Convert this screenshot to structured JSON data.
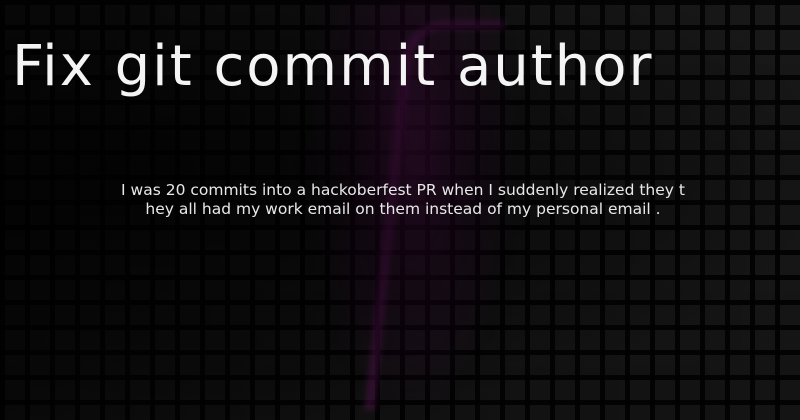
{
  "header": {
    "title": "Fix git commit author"
  },
  "main": {
    "description": "I was 20 commits into a hackoberfest PR when I suddenly realized they they all had my work email on them instead of my personal email ."
  },
  "colors": {
    "background": "#0d0d0d",
    "text": "#f4f4f4",
    "accent_glow": "#8c1e85"
  }
}
